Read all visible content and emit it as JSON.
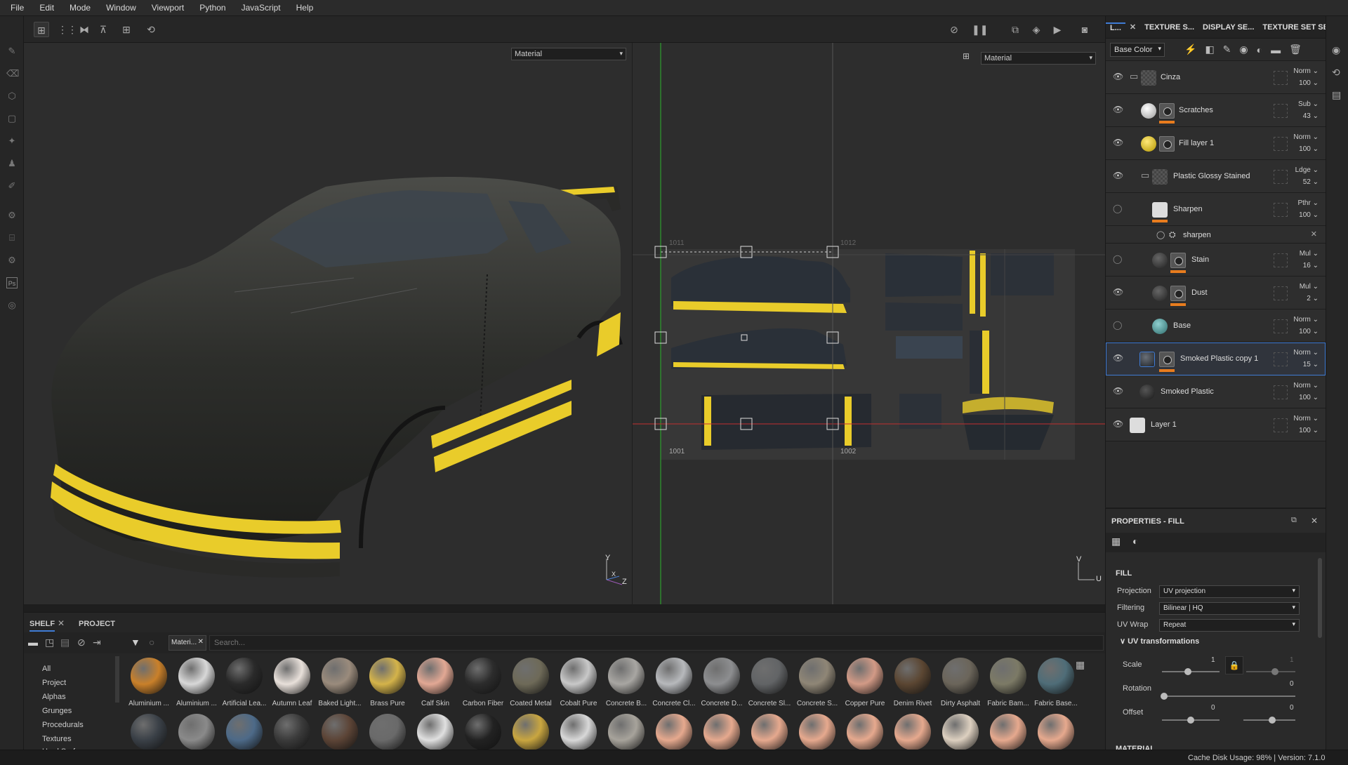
{
  "menu": [
    "File",
    "Edit",
    "Mode",
    "Window",
    "Viewport",
    "Python",
    "JavaScript",
    "Help"
  ],
  "viewport3d": {
    "material_select": "Material",
    "axis_y": "Y",
    "axis_x": "X",
    "axis_z": "Z"
  },
  "viewport2d": {
    "material_select": "Material",
    "udim_1001": "1001",
    "udim_1002": "1002",
    "udim_1011": "1011",
    "udim_1012": "1012",
    "axis_v": "V",
    "axis_u": "U"
  },
  "layers_panel": {
    "tabs": [
      "L...",
      "TEXTURE S...",
      "DISPLAY SE...",
      "TEXTURE SET SE..."
    ],
    "channel": "Base Color",
    "rows": [
      {
        "name": "Cinza",
        "blend": "Norm",
        "opacity": "100"
      },
      {
        "name": "Scratches",
        "blend": "Sub",
        "opacity": "43"
      },
      {
        "name": "Fill layer 1",
        "blend": "Norm",
        "opacity": "100"
      },
      {
        "name": "Plastic Glossy Stained",
        "blend": "Ldge",
        "opacity": "52"
      },
      {
        "name": "Sharpen",
        "blend": "Pthr",
        "opacity": "100"
      },
      {
        "name": "sharpen",
        "blend": "",
        "opacity": ""
      },
      {
        "name": "Stain",
        "blend": "Mul",
        "opacity": "16"
      },
      {
        "name": "Dust",
        "blend": "Mul",
        "opacity": "2"
      },
      {
        "name": "Base",
        "blend": "Norm",
        "opacity": "100"
      },
      {
        "name": "Smoked Plastic copy 1",
        "blend": "Norm",
        "opacity": "15"
      },
      {
        "name": "Smoked Plastic",
        "blend": "Norm",
        "opacity": "100"
      },
      {
        "name": "Layer 1",
        "blend": "Norm",
        "opacity": "100"
      }
    ]
  },
  "properties": {
    "title": "PROPERTIES - FILL",
    "section": "FILL",
    "projection_label": "Projection",
    "projection_value": "UV projection",
    "filtering_label": "Filtering",
    "filtering_value": "Bilinear | HQ",
    "uvwrap_label": "UV Wrap",
    "uvwrap_value": "Repeat",
    "uvtrans_label": "UV transformations",
    "scale_label": "Scale",
    "scale_value": "1",
    "scale_value2": "1",
    "rotation_label": "Rotation",
    "rotation_value": "0",
    "offset_label": "Offset",
    "offset_value1": "0",
    "offset_value2": "0",
    "next_section": "MATERIAL"
  },
  "shelf": {
    "tab_shelf": "SHELF",
    "tab_project": "PROJECT",
    "filter_chip": "Materi...",
    "search_placeholder": "Search...",
    "categories": [
      "All",
      "Project",
      "Alphas",
      "Grunges",
      "Procedurals",
      "Textures",
      "Hard Surfaces"
    ],
    "materials": [
      {
        "name": "Aluminium ...",
        "color": "#c9802a"
      },
      {
        "name": "Aluminium ...",
        "color": "#d8d8d8"
      },
      {
        "name": "Artificial Lea...",
        "color": "#2a2a2a"
      },
      {
        "name": "Autumn Leaf",
        "color": "#e8e0da"
      },
      {
        "name": "Baked Light...",
        "color": "#9a8b7c"
      },
      {
        "name": "Brass Pure",
        "color": "#d4b34a"
      },
      {
        "name": "Calf Skin",
        "color": "#e2a894"
      },
      {
        "name": "Carbon Fiber",
        "color": "#2c2c2c"
      },
      {
        "name": "Coated Metal",
        "color": "#6e6a58"
      },
      {
        "name": "Cobalt Pure",
        "color": "#c8c8c8"
      },
      {
        "name": "Concrete B...",
        "color": "#a8a6a2"
      },
      {
        "name": "Concrete Cl...",
        "color": "#b7b9bc"
      },
      {
        "name": "Concrete D...",
        "color": "#8d8e90"
      },
      {
        "name": "Concrete Sl...",
        "color": "#626466"
      },
      {
        "name": "Concrete S...",
        "color": "#8f8676"
      },
      {
        "name": "Copper Pure",
        "color": "#d29a86"
      },
      {
        "name": "Denim Rivet",
        "color": "#5b4632"
      },
      {
        "name": "Dirty Asphalt",
        "color": "#6b655a"
      },
      {
        "name": "Fabric Bam...",
        "color": "#7c7a66"
      },
      {
        "name": "Fabric Base...",
        "color": "#4f6d78"
      }
    ],
    "row2_colors": [
      "#3a4047",
      "#8a8a8a",
      "#4d6a88",
      "#3a3a3a",
      "#5c4436",
      "#6a6a6a",
      "#e0e0e0",
      "#222222",
      "#c9a640",
      "#d8d8d8",
      "#a7a39b",
      "#e6a98e",
      "#e6a98e",
      "#e6a98e",
      "#e6a98e",
      "#e6a98e",
      "#e6a98e",
      "#ddd0c0",
      "#e6a98e",
      "#e6a98e"
    ]
  },
  "status": {
    "cache": "Cache Disk Usage:",
    "cache_value": "98%",
    "version": "Version: 7.1.0"
  },
  "colors": {
    "accent": "#3f7bd4",
    "orange": "#e87c1e",
    "uv_green": "#2db52d",
    "uv_red": "#c22f2f"
  }
}
